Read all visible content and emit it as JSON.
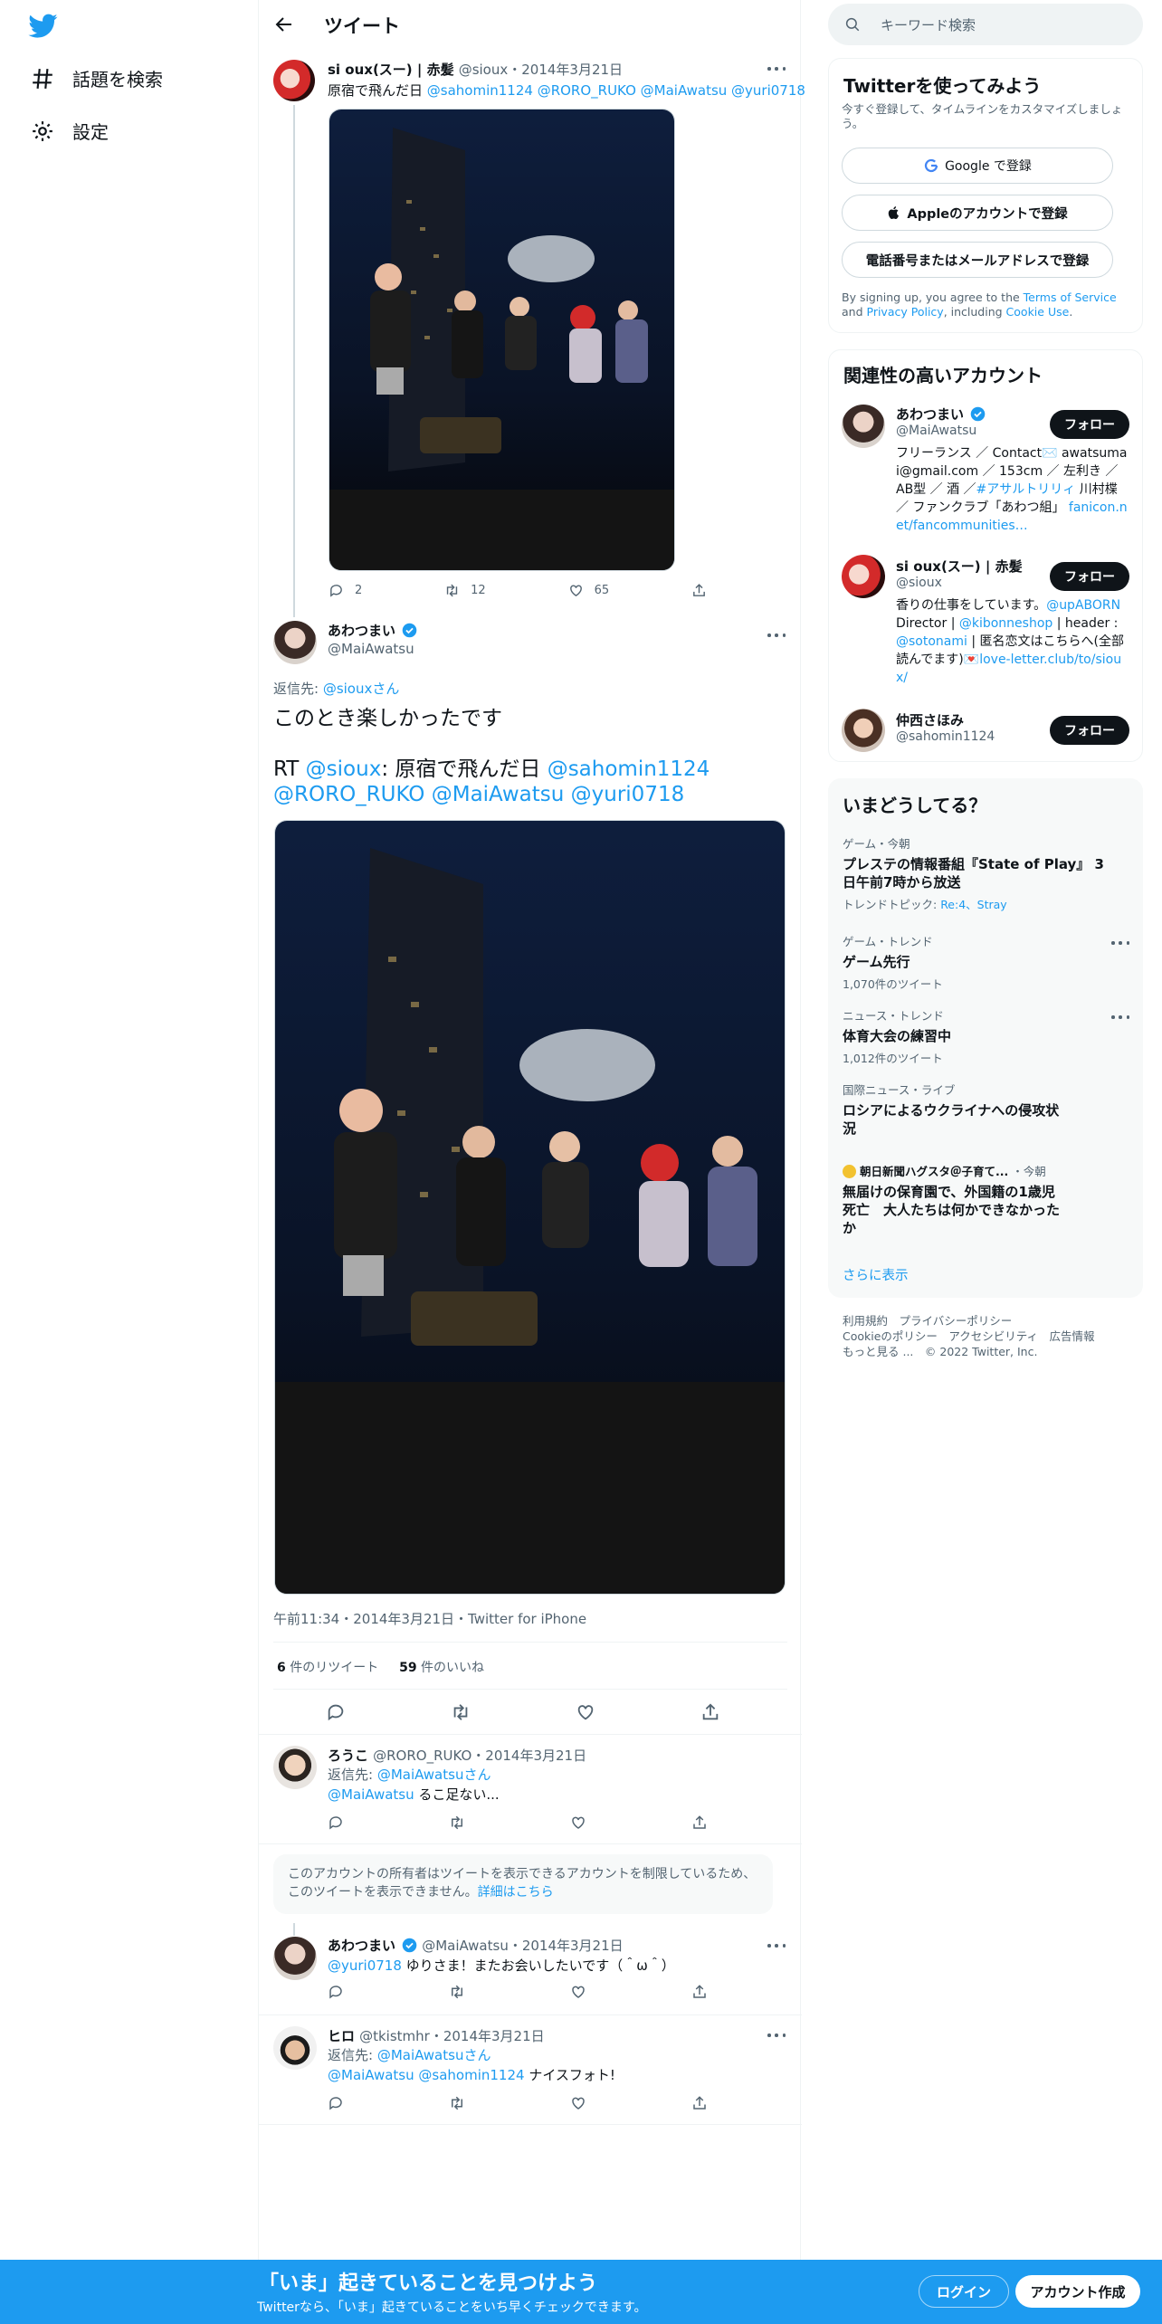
{
  "nav": {
    "explore_label": "話題を検索",
    "settings_label": "設定"
  },
  "header": {
    "title": "ツイート"
  },
  "parent_tweet": {
    "name": "si oux(スー) | 赤髪",
    "handle": "@sioux",
    "date": "・2014年3月21日",
    "text_prefix": "原宿で飛んだ日 ",
    "mentions": "@sahomin1124 @RORO_RUKO @MaiAwatsu @yuri0718",
    "replies": "2",
    "retweets": "12",
    "likes": "65"
  },
  "main_tweet": {
    "name": "あわつまい",
    "handle": "@MaiAwatsu",
    "reply_to_prefix": "返信先: ",
    "reply_to_handle": "@siouxさん",
    "line1": "このとき楽しかったです",
    "rt_prefix": "RT ",
    "rt_user": "@sioux",
    "rt_text": ": 原宿で飛んだ日 ",
    "rt_mention1": "@sahomin1124",
    "rt_mention2": "@RORO_RUKO @MaiAwatsu @yuri0718",
    "timestamp": "午前11:34・2014年3月21日・Twitter for iPhone",
    "retweets_count": "6",
    "retweets_label": " 件のリツイート",
    "likes_count": "59",
    "likes_label": " 件のいいね"
  },
  "replies": [
    {
      "name": "ろうこ",
      "handle": "@RORO_RUKO",
      "date": "・2014年3月21日",
      "reply_to_prefix": "返信先: ",
      "reply_to_handle": "@MaiAwatsuさん",
      "mention": "@MaiAwatsu",
      "text": " るこ足ない..."
    },
    {
      "name": "あわつまい",
      "handle": "@MaiAwatsu",
      "date": "・2014年3月21日",
      "mention": "@yuri0718",
      "text": " ゆりさま！またお会いしたいです（＾ω＾）"
    },
    {
      "name": "ヒロ",
      "handle": "@tkistmhr",
      "date": "・2014年3月21日",
      "reply_to_prefix": "返信先: ",
      "reply_to_handle": "@MaiAwatsuさん",
      "mention": "@MaiAwatsu @sahomin1124",
      "text": " ナイスフォト!"
    }
  ],
  "restricted_notice": {
    "text": "このアカウントの所有者はツイートを表示できるアカウントを制限しているため、このツイートを表示できません。",
    "link": "詳細はこちら"
  },
  "sidebar": {
    "search_placeholder": "キーワード検索",
    "signup": {
      "title": "Twitterを使ってみよう",
      "subtitle": "今すぐ登録して、タイムラインをカスタマイズしましょう。",
      "google_button": "Google で登録",
      "apple_button": "Appleのアカウントで登録",
      "phone_button": "電話番号またはメールアドレスで登録",
      "legal_prefix": "By signing up, you agree to the ",
      "legal_terms": "Terms of Service",
      "legal_and": " and ",
      "legal_privacy": "Privacy Policy",
      "legal_including": ", including ",
      "legal_cookie": "Cookie Use",
      "legal_end": "."
    },
    "related": {
      "title": "関連性の高いアカウント",
      "follow_label": "フォロー",
      "accounts": [
        {
          "name": "あわつまい",
          "handle": "@MaiAwatsu",
          "bio_a": "フリーランス ／ Contact✉️ awatsumai@gmail.com ／ 153cm ／ 左利き ／ AB型 ／ 酒 ／",
          "bio_link1": "#アサルトリリィ",
          "bio_b": " 川村楪 ／ ファンクラブ「あわつ組」 ",
          "bio_link2": "fanicon.net/fancommunities…"
        },
        {
          "name": "si oux(スー) | 赤髪",
          "handle": "@sioux",
          "bio_a": "香りの仕事をしています。",
          "bio_link1": "@upABORN",
          "bio_b": " Director | ",
          "bio_link2": "@kibonneshop",
          "bio_c": " | header : ",
          "bio_link3": "@sotonami",
          "bio_d": " | 匿名恋文はこちらへ(全部読んでます)💌",
          "bio_link4": "love-letter.club/to/sioux/"
        },
        {
          "name": "仲西さほみ",
          "handle": "@sahomin1124"
        }
      ]
    },
    "trends": {
      "title": "いまどうしてる？",
      "items": [
        {
          "meta": "ゲーム・今朝",
          "title": "プレステの情報番組『State of Play』 3日午前7時から放送",
          "extra_label": "トレンドトピック: ",
          "extra_links": "Re:4、Stray"
        },
        {
          "meta": "ゲーム・トレンド",
          "title": "ゲーム先行",
          "count": "1,070件のツイート"
        },
        {
          "meta": "ニュース・トレンド",
          "title": "体育大会の練習中",
          "count": "1,012件のツイート"
        },
        {
          "meta": "国際ニュース・ライブ",
          "title": "ロシアによるウクライナへの侵攻状況"
        },
        {
          "source": "朝日新聞ハグスタ＠子育て...",
          "meta": "・今朝",
          "title": "無届けの保育園で、外国籍の1歳児死亡　大人たちは何かできなかったか"
        }
      ],
      "show_more": "さらに表示"
    },
    "footer": {
      "line1": "利用規約　プライバシーポリシー",
      "line2": "Cookieのポリシー　アクセシビリティ　広告情報",
      "line3": "もっと見る ...　© 2022 Twitter, Inc."
    }
  },
  "bottom_bar": {
    "title": "「いま」起きていることを見つけよう",
    "subtitle": "Twitterなら、「いま」起きていることをいち早くチェックできます。",
    "login": "ログイン",
    "signup": "アカウント作成"
  },
  "colors": {
    "accent": "#1d9bf0",
    "text": "#0f1419",
    "secondary": "#536471"
  }
}
